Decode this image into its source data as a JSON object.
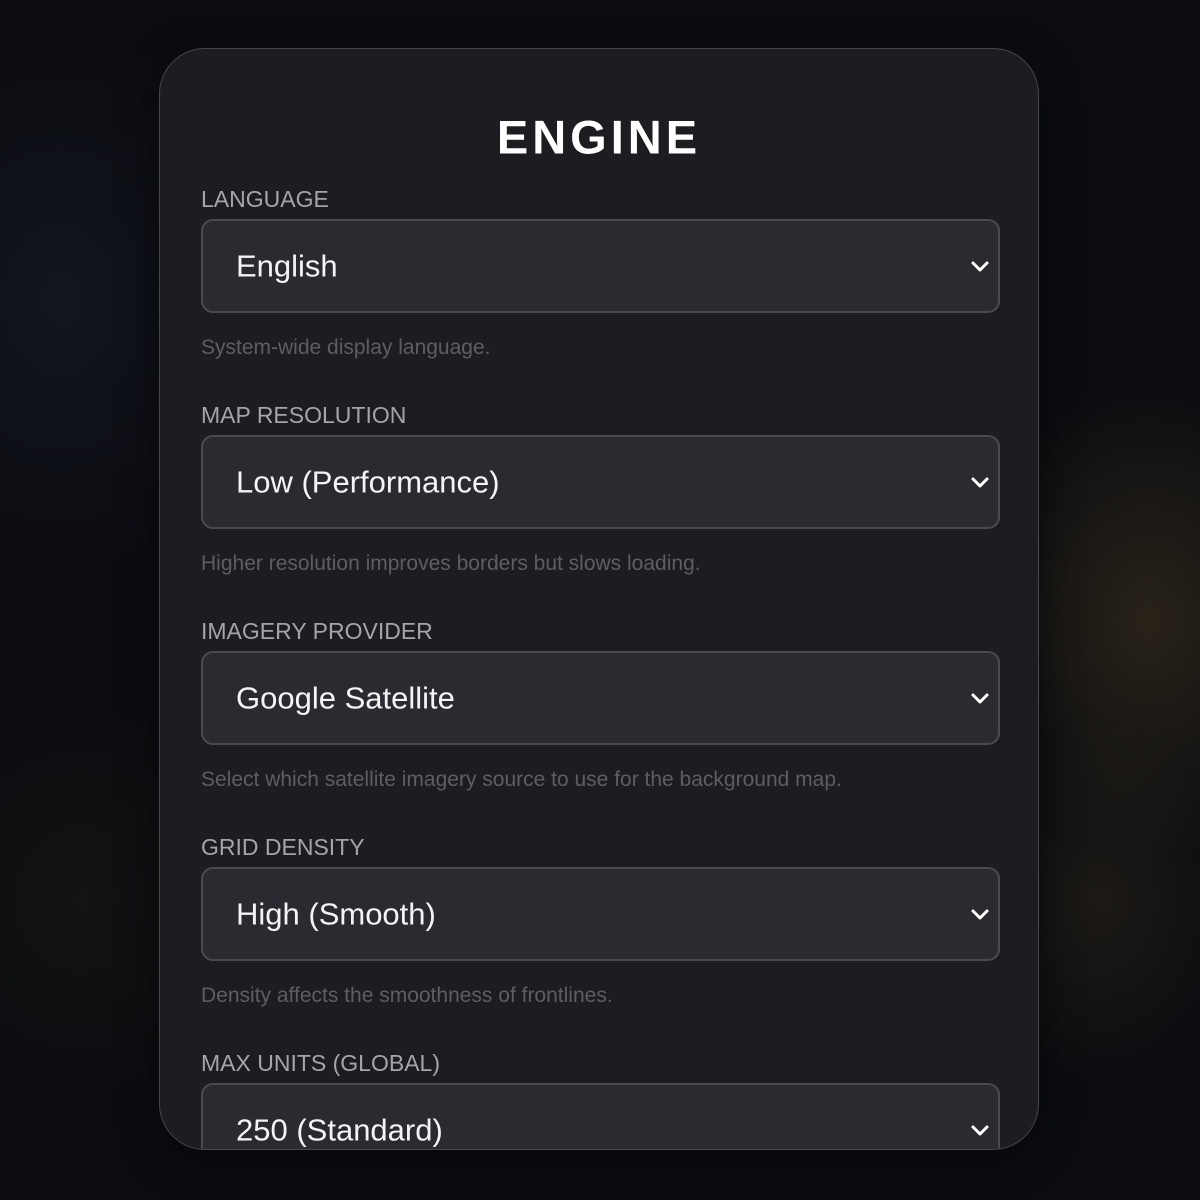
{
  "panel": {
    "title": "ENGINE"
  },
  "fields": [
    {
      "label": "LANGUAGE",
      "value": "English",
      "help": "System-wide display language."
    },
    {
      "label": "MAP RESOLUTION",
      "value": "Low (Performance)",
      "help": "Higher resolution improves borders but slows loading."
    },
    {
      "label": "IMAGERY PROVIDER",
      "value": "Google Satellite",
      "help": "Select which satellite imagery source to use for the background map."
    },
    {
      "label": "GRID DENSITY",
      "value": "High (Smooth)",
      "help": "Density affects the smoothness of frontlines."
    },
    {
      "label": "MAX UNITS (GLOBAL)",
      "value": "250 (Standard)",
      "help": ""
    }
  ],
  "icons": {
    "dropdown": "chevron-down-icon"
  },
  "colors": {
    "panel_bg": "#1d1d21",
    "select_bg": "#2b2a31",
    "label": "#a4a4aa",
    "help": "#5d5d63",
    "title": "#ffffff"
  }
}
